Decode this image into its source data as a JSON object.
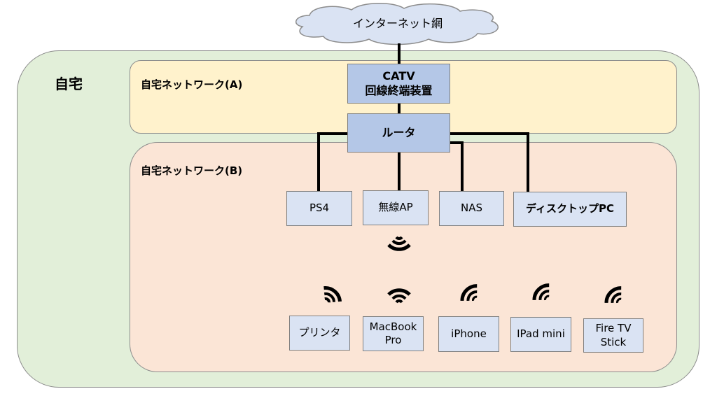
{
  "cloud": {
    "label": "インターネット網"
  },
  "home": {
    "label": "自宅"
  },
  "zone_a": {
    "label": "自宅ネットワーク(A)"
  },
  "zone_b": {
    "label": "自宅ネットワーク(B)"
  },
  "catv": {
    "line1": "CATV",
    "line2": "回線終端装置"
  },
  "router": {
    "label": "ルータ"
  },
  "wired_devices": [
    "PS4",
    "無線AP",
    "NAS",
    "ディスクトップPC"
  ],
  "wireless_devices": [
    {
      "line1": "プリンタ",
      "line2": ""
    },
    {
      "line1": "MacBook",
      "line2": "Pro"
    },
    {
      "line1": "iPhone",
      "line2": ""
    },
    {
      "line1": "IPad mini",
      "line2": ""
    },
    {
      "line1": "Fire TV",
      "line2": "Stick"
    }
  ],
  "colors": {
    "home": "#e2efd9",
    "zone_a": "#fff2cc",
    "zone_b": "#fbe5d6",
    "core_box": "#b4c7e7",
    "device_box": "#dae3f3",
    "cloud": "#dae3f3"
  }
}
